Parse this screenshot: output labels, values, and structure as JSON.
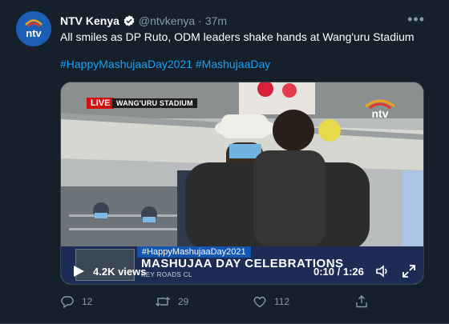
{
  "tweet": {
    "author_name": "NTV Kenya",
    "handle": "@ntvkenya",
    "separator": "·",
    "time": "37m",
    "more_label": "•••",
    "text": "All smiles as DP Ruto, ODM leaders shake hands at Wang'uru Stadium",
    "hashtags": [
      "#HappyMashujaaDay2021",
      "#MashujaaDay"
    ]
  },
  "video": {
    "live_label": "LIVE",
    "venue_label": "WANG'URU STADIUM",
    "lower_third_tag": "#HappyMashujaaDay2021",
    "lower_third_title": "MASHUJAA DAY CELEBRATIONS",
    "lower_third_sub": "KEY ROADS CL",
    "views": "4.2K views",
    "timecode": "0:10 / 1:26"
  },
  "actions": {
    "replies": "12",
    "retweets": "29",
    "likes": "112"
  },
  "colors": {
    "background": "#15202b",
    "accent": "#1da1f2",
    "muted": "#8899a6",
    "live_red": "#d40f14"
  }
}
